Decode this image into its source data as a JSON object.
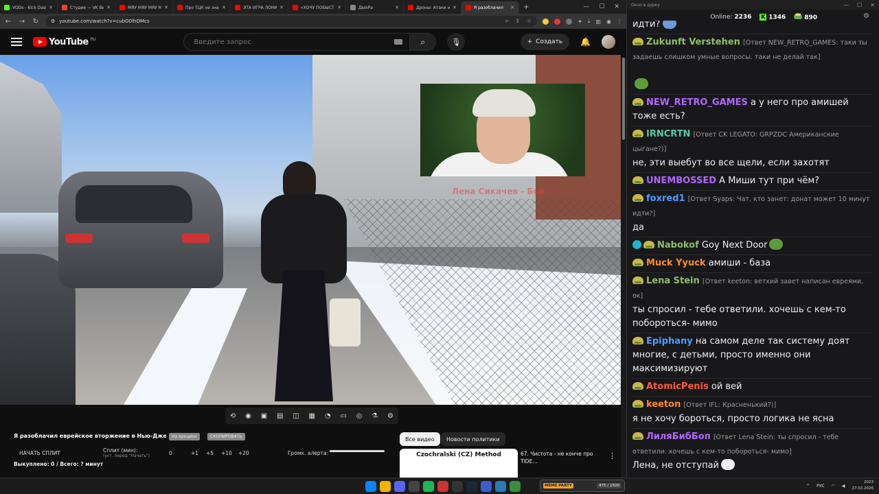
{
  "browser": {
    "tabs": [
      {
        "title": "VODs - Kick Dashb",
        "color": "#53fc18"
      },
      {
        "title": "Студия — VK Видео",
        "color": "#ff3b30"
      },
      {
        "title": "МЯУ МЯУ МЯУ МЯУ",
        "color": "#ff0000"
      },
      {
        "title": "Про ТЦК не знаю",
        "color": "#ff0000"
      },
      {
        "title": "ЭТА ИГРА ЛОМАЕ",
        "color": "#ff0000"
      },
      {
        "title": "«ХОЧУ ПОБЫСТРЕ",
        "color": "#ff0000"
      },
      {
        "title": "ДЫхРа",
        "color": "#888888"
      },
      {
        "title": "Дроны: Атаки на Р",
        "color": "#ff0000"
      },
      {
        "title": "Я разоблачил",
        "color": "#ff0000"
      }
    ],
    "url": "youtube.com/watch?v=cubO0lhOMcs"
  },
  "youtube": {
    "logo_text": "YouTube",
    "region": "RU",
    "search_placeholder": "Введите запрос",
    "create_label": "Создать",
    "pip_caption": "Лена Сикачев - Бой",
    "video_title": "Я разоблачил еврейское вторжение в Нью-Джерси...",
    "chip1": "На аукцион",
    "chip2": "СКОПИРОВАТЬ",
    "split_button": "НАЧАТЬ СПЛИТ",
    "split_label": "Сплит (мин):",
    "split_hint": "(уст. перед \"Начать\")",
    "split_value": "0",
    "increments": [
      "+1",
      "+5",
      "+10",
      "+20"
    ],
    "alert_volume_label": "Громк. алерта:",
    "bought": "Выкуплено: 0 / Всего: ? минут",
    "filter_all": "Все видео",
    "filter_news": "Новости политики",
    "rec_thumb_text": "Czochralski (CZ) Method",
    "rec_title": "67. Чистота - не конче про TIDE..."
  },
  "chat": {
    "window_title": "Окно в дурку",
    "online_label": "Online:",
    "online_value": "2236",
    "kick_count": "1346",
    "other_count": "890",
    "messages": [
      {
        "nick": "",
        "color": "#efeff1",
        "reply": "",
        "text": "идти?"
      },
      {
        "nick": "Zukunft Verstehen",
        "color": "#8fbf6a",
        "reply": "[Ответ NEW_RETRO_GAMES: таки ты задаешь слишком умные вопросы. таки не делай так]",
        "text": ""
      },
      {
        "nick": "NEW_RETRO_GAMES",
        "color": "#b266ff",
        "reply": "",
        "text": "а у него про амишей тоже есть?"
      },
      {
        "nick": "IRNCRTN",
        "color": "#57c7a0",
        "reply": "[Ответ CK LEGATO: GRPZDC Американские цыгане?)]",
        "text": "не, эти выебут во все щели, если захотят"
      },
      {
        "nick": "UNEMBOSSED",
        "color": "#b266ff",
        "reply": "",
        "text": "А Миши тут при чём?"
      },
      {
        "nick": "foxred1",
        "color": "#4d9cff",
        "reply": "[Ответ Syaps: Чат, кто занет: донат может 10 минут идти?]",
        "text": "да"
      },
      {
        "nick": "Nabokof",
        "color": "#8fbf6a",
        "reply": "",
        "text": "Goy Next Door"
      },
      {
        "nick": "Muck Yyuck",
        "color": "#ff8c2b",
        "reply": "",
        "text": "амиши - база"
      },
      {
        "nick": "Lena Stein",
        "color": "#8fbf6a",
        "reply": "[Ответ keeton: ветхий завет написан евреями, ок]",
        "text": "ты спросил - тебе ответили. хочешь с кем-то побороться- мимо"
      },
      {
        "nick": "Epiphany",
        "color": "#4d9cff",
        "reply": "",
        "text": "на самом деле так систему доят многие, с детьми, просто именно они максимизируют"
      },
      {
        "nick": "AtomicPenis",
        "color": "#ff5a3c",
        "reply": "",
        "text": "ой вей"
      },
      {
        "nick": "keeton",
        "color": "#ff8c2b",
        "reply": "[Ответ IFL: Красненький?)]",
        "text": "я не хочу бороться, просто логика не ясна"
      },
      {
        "nick": "ЛиляБибБоп",
        "color": "#b266ff",
        "reply": "[Ответ Lena Stein: ты спросил - тебе ответили. хочешь с кем-то побороться- мимо]",
        "text": "Лена, не отступай"
      }
    ]
  },
  "taskbar": {
    "meme_party": "MEME PARTY",
    "meme_counter": "475 / 1500",
    "lang": "РУС",
    "time": "2023",
    "date": "27.02.2026"
  }
}
